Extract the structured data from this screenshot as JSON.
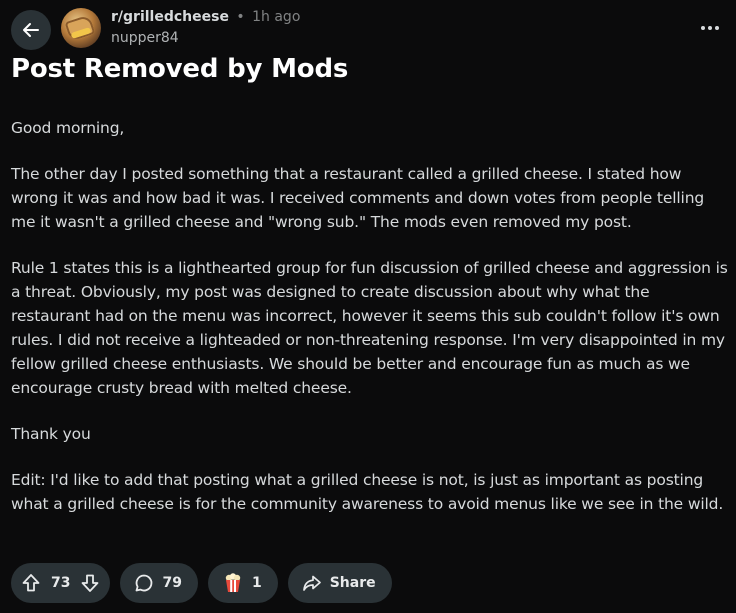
{
  "header": {
    "subreddit": "r/grilledcheese",
    "separator": "•",
    "time": "1h ago",
    "username": "nupper84"
  },
  "post": {
    "title": "Post Removed by Mods",
    "paragraphs": [
      "Good morning,",
      "The other day I posted something that a restaurant called a grilled cheese. I stated how wrong it was and how bad it was. I received comments and down votes from people telling me it wasn't a grilled cheese and \"wrong sub.\" The mods even removed my post.",
      "Rule 1 states this is a lighthearted group for fun discussion of grilled cheese and aggression is a threat. Obviously, my post was designed to create discussion about why what the restaurant had on the menu was incorrect, however it seems this sub couldn't follow it's own rules. I did not receive a lighteaded or non-threatening response. I'm very disappointed in my fellow grilled cheese enthusiasts. We should be better and encourage fun as much as we encourage crusty bread with melted cheese.",
      "Thank you",
      "Edit: I'd like to add that posting what a grilled cheese is not, is just as important as posting what a grilled cheese is for the community awareness to avoid menus like we see in the wild."
    ]
  },
  "actions": {
    "votes": "73",
    "comments": "79",
    "awards": "1",
    "share_label": "Share"
  },
  "icons": {
    "back": "arrow-left-icon",
    "more": "more-horizontal-icon",
    "upvote": "arrow-up-icon",
    "downvote": "arrow-down-icon",
    "comment": "speech-bubble-icon",
    "award": "popcorn-award-icon",
    "share": "share-arrow-icon"
  },
  "colors": {
    "background": "#0b0b0c",
    "pill": "#2a3236",
    "text": "#d7dadc",
    "muted": "#818384"
  }
}
